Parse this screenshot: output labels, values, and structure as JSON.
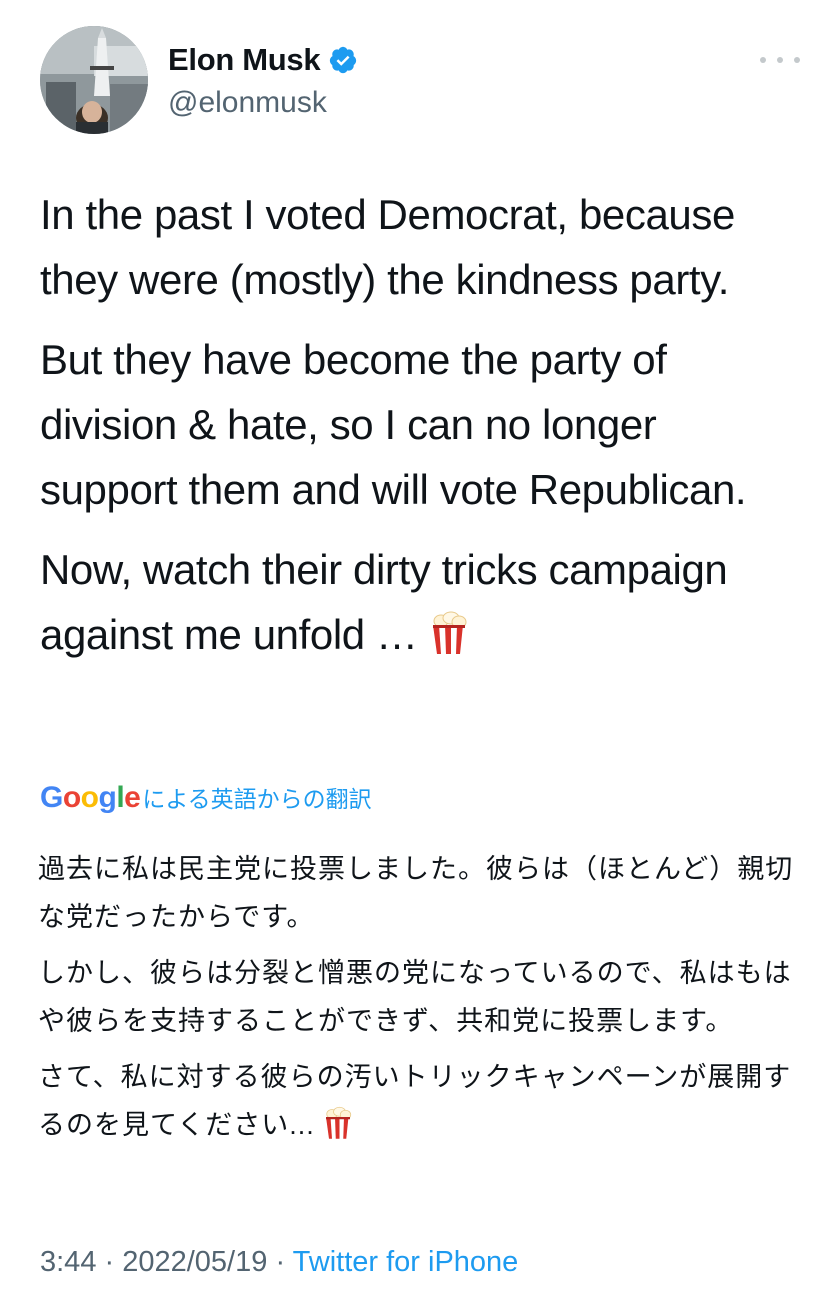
{
  "author": {
    "display_name": "Elon Musk",
    "handle": "@elonmusk",
    "verified": true
  },
  "tweet": {
    "paragraphs": [
      "In the past I voted Democrat, because they were (mostly) the kindness party.",
      "But they have become the party of division & hate, so I can no longer support them and will vote Republican.",
      "Now, watch their dirty tricks campaign against me unfold …"
    ],
    "trailing_emoji": "popcorn"
  },
  "translation": {
    "provider_logo": "Google",
    "caption": "による英語からの翻訳",
    "paragraphs": [
      "過去に私は民主党に投票しました。彼らは（ほとんど）親切な党だったからです。",
      "しかし、彼らは分裂と憎悪の党になっているので、私はもはや彼らを支持することができず、共和党に投票します。",
      "さて、私に対する彼らの汚いトリックキャンペーンが展開するのを見てください..."
    ]
  },
  "meta": {
    "time": "3:44",
    "separator": " · ",
    "date": "2022/05/19",
    "source": "Twitter for iPhone"
  },
  "colors": {
    "link_blue": "#1d9bf0",
    "secondary_text": "#536471",
    "primary_text": "#0f1419"
  },
  "icons": {
    "verified": "verified-badge-icon",
    "more": "more-options-icon",
    "emoji": "popcorn-emoji"
  }
}
